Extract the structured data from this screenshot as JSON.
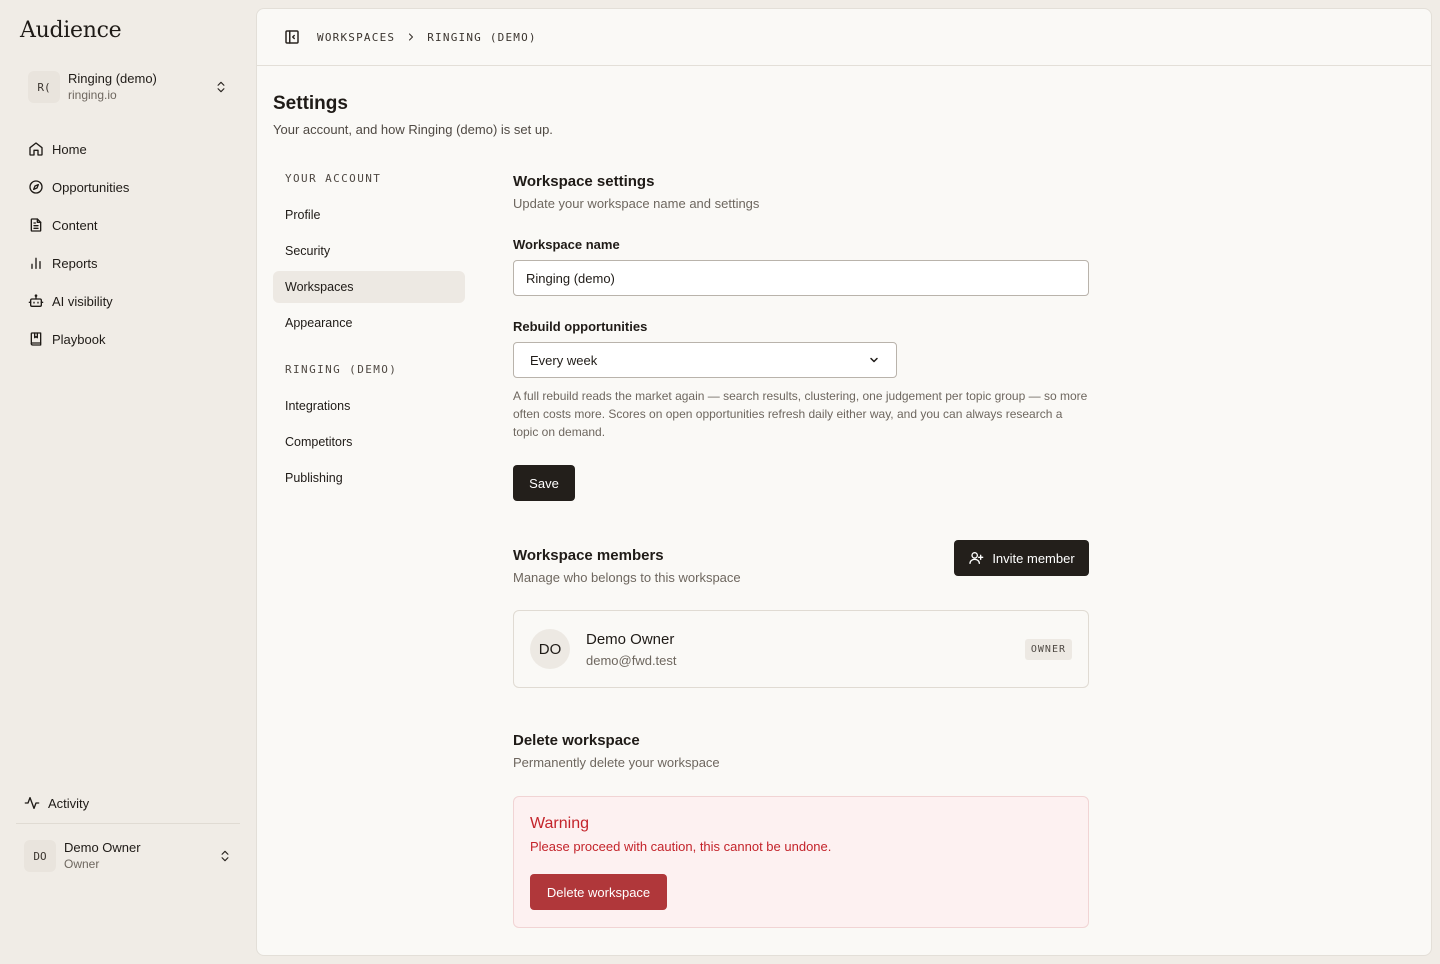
{
  "brand": "Audience",
  "workspace": {
    "initials": "R(",
    "name": "Ringing (demo)",
    "domain": "ringing.io"
  },
  "nav": {
    "items": [
      {
        "label": "Home",
        "icon": "home-icon"
      },
      {
        "label": "Opportunities",
        "icon": "compass-icon"
      },
      {
        "label": "Content",
        "icon": "document-icon"
      },
      {
        "label": "Reports",
        "icon": "bar-chart-icon"
      },
      {
        "label": "AI visibility",
        "icon": "robot-icon"
      },
      {
        "label": "Playbook",
        "icon": "book-icon"
      }
    ],
    "activity": "Activity"
  },
  "user": {
    "initials": "DO",
    "name": "Demo Owner",
    "role": "Owner"
  },
  "breadcrumb": {
    "root": "WORKSPACES",
    "current": "RINGING (DEMO)"
  },
  "page": {
    "title": "Settings",
    "subtitle": "Your account, and how Ringing (demo) is set up."
  },
  "subnav": {
    "account_heading": "YOUR ACCOUNT",
    "account_items": [
      "Profile",
      "Security",
      "Workspaces",
      "Appearance"
    ],
    "workspace_heading": "RINGING (DEMO)",
    "workspace_items": [
      "Integrations",
      "Competitors",
      "Publishing"
    ],
    "active": "Workspaces"
  },
  "settings": {
    "title": "Workspace settings",
    "subtitle": "Update your workspace name and settings",
    "name_label": "Workspace name",
    "name_value": "Ringing (demo)",
    "rebuild_label": "Rebuild opportunities",
    "rebuild_value": "Every week",
    "help": "A full rebuild reads the market again — search results, clustering, one judgement per topic group — so more often costs more. Scores on open opportunities refresh daily either way, and you can always research a topic on demand.",
    "save_label": "Save"
  },
  "members": {
    "title": "Workspace members",
    "subtitle": "Manage who belongs to this workspace",
    "invite_label": "Invite member",
    "list": [
      {
        "initials": "DO",
        "name": "Demo Owner",
        "email": "demo@fwd.test",
        "role": "OWNER"
      }
    ]
  },
  "delete": {
    "title": "Delete workspace",
    "subtitle": "Permanently delete your workspace",
    "warning_title": "Warning",
    "warning_text": "Please proceed with caution, this cannot be undone.",
    "button_label": "Delete workspace"
  },
  "colors": {
    "accent_dark": "#231f1b",
    "danger": "#c4242b",
    "danger_button": "#b0373a",
    "background": "#f0ece6",
    "panel": "#faf9f6"
  }
}
